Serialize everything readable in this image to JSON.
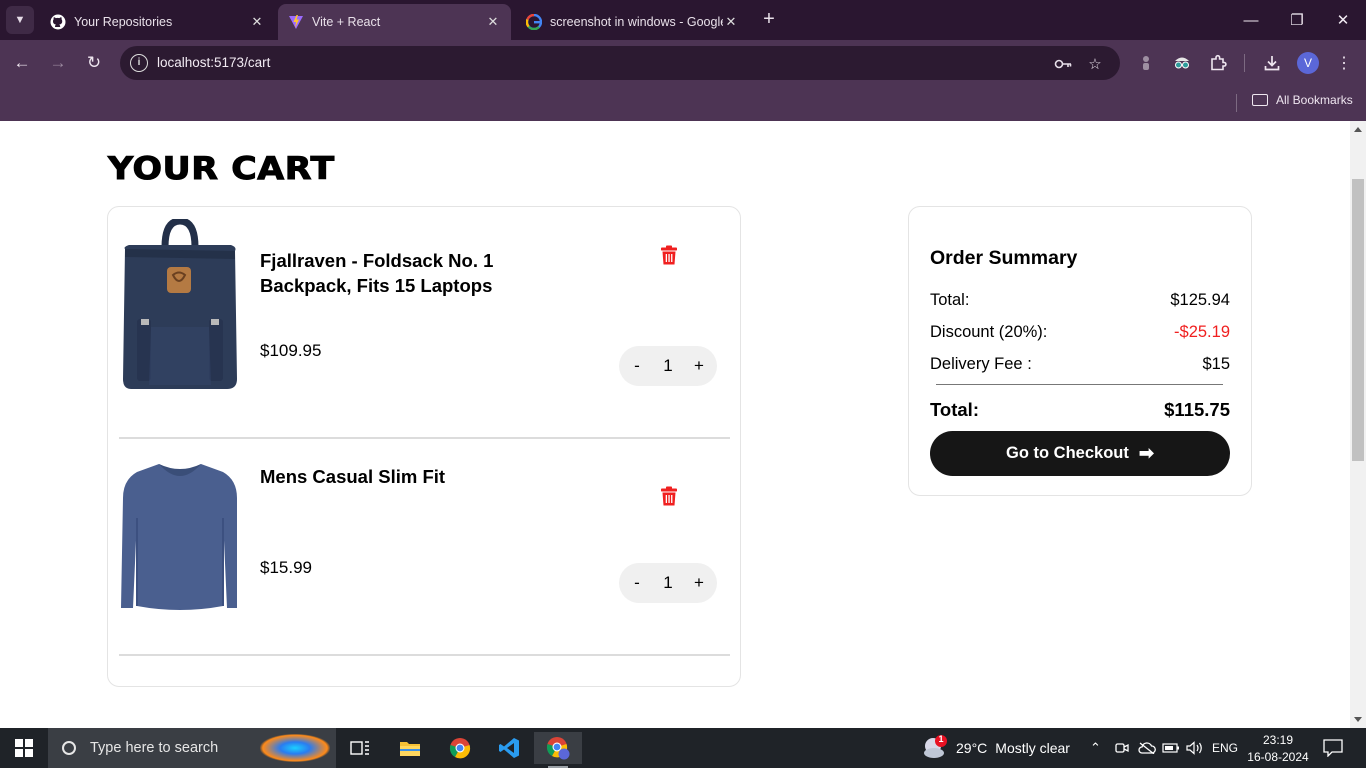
{
  "browser": {
    "tabs": [
      {
        "title": "Your Repositories",
        "icon": "github-icon"
      },
      {
        "title": "Vite + React",
        "icon": "vite-icon",
        "active": true
      },
      {
        "title": "screenshot in windows - Google",
        "icon": "google-icon"
      }
    ],
    "url": "localhost:5173/cart",
    "bookmarks_label": "All Bookmarks",
    "profile_initial": "V",
    "theme_color": "#4d3454"
  },
  "page": {
    "title": "YOUR CART",
    "items": [
      {
        "name": "Fjallraven - Foldsack No. 1 Backpack, Fits 15 Laptops",
        "price": "$109.95",
        "qty": "1"
      },
      {
        "name": "Mens Casual Slim Fit",
        "price": "$15.99",
        "qty": "1"
      }
    ],
    "qty_minus": "-",
    "qty_plus": "+",
    "summary": {
      "heading": "Order Summary",
      "total_label": "Total:",
      "total_value": "$125.94",
      "discount_label": "Discount (20%):",
      "discount_value": "-$25.19",
      "delivery_label": "Delivery Fee :",
      "delivery_value": "$15",
      "grand_label": "Total:",
      "grand_value": "$115.75",
      "checkout_label": "Go to Checkout"
    },
    "colors": {
      "accent": "#161616",
      "danger": "#f02020"
    }
  },
  "taskbar": {
    "search_placeholder": "Type here to search",
    "weather_temp": "29°C",
    "weather_text": "Mostly clear",
    "weather_badge": "1",
    "language": "ENG",
    "time": "23:19",
    "date": "16-08-2024"
  }
}
